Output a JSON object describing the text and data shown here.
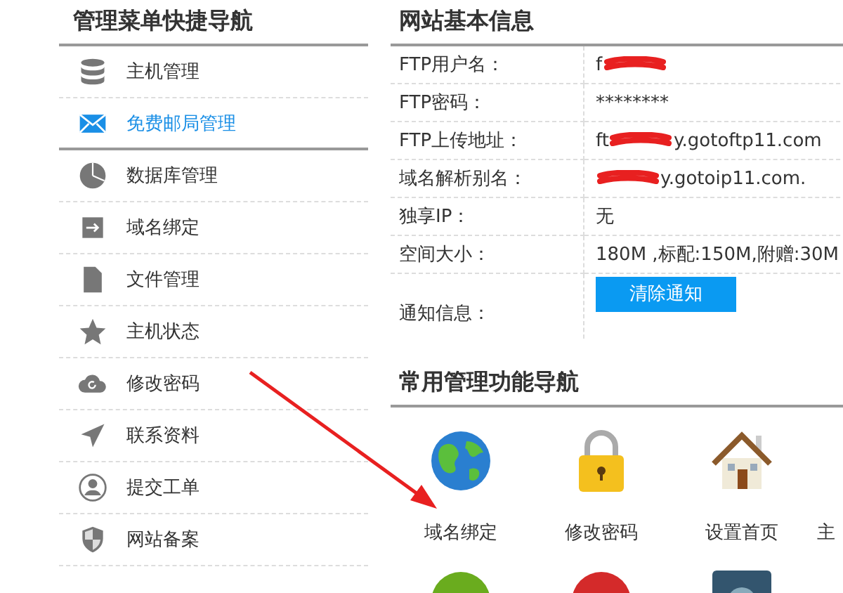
{
  "sidebar": {
    "title": "管理菜单快捷导航",
    "items": [
      {
        "label": "主机管理",
        "selected": false
      },
      {
        "label": "免费邮局管理",
        "selected": true
      },
      {
        "label": "数据库管理",
        "selected": false
      },
      {
        "label": "域名绑定",
        "selected": false
      },
      {
        "label": "文件管理",
        "selected": false
      },
      {
        "label": "主机状态",
        "selected": false
      },
      {
        "label": "修改密码",
        "selected": false
      },
      {
        "label": "联系资料",
        "selected": false
      },
      {
        "label": "提交工单",
        "selected": false
      },
      {
        "label": "网站备案",
        "selected": false
      }
    ]
  },
  "site_info": {
    "title": "网站基本信息",
    "rows": [
      {
        "label": "FTP用户名：",
        "value_before": "f",
        "redacted": true
      },
      {
        "label": "FTP密码：",
        "value_before": "********",
        "redacted": false
      },
      {
        "label": "FTP上传地址：",
        "value_before": "ft",
        "value_after": "y.gotoftp11.com",
        "redacted": true
      },
      {
        "label": "域名解析别名：",
        "value_after": "y.gotoip11.com.",
        "redacted": true
      },
      {
        "label": "独享IP：",
        "value_before": "无",
        "redacted": false
      },
      {
        "label": "空间大小：",
        "value_before": "180M ,标配:150M,附赠:30M",
        "redacted": false
      }
    ],
    "notice": {
      "label": "通知信息：",
      "button": "清除通知"
    }
  },
  "quick_nav": {
    "title": "常用管理功能导航",
    "items": [
      {
        "label": "域名绑定"
      },
      {
        "label": "修改密码"
      },
      {
        "label": "设置首页"
      },
      {
        "label": "主"
      }
    ]
  }
}
